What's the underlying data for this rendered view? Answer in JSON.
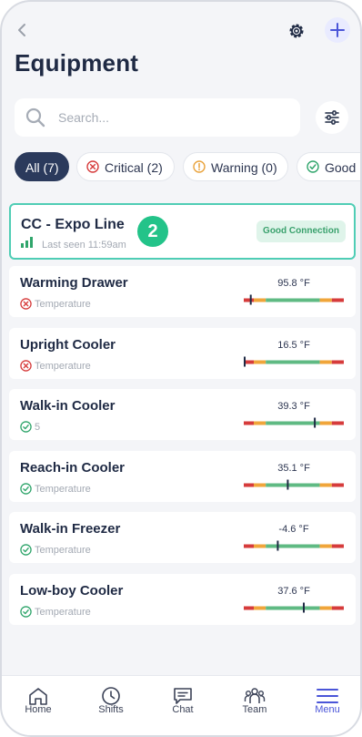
{
  "header": {
    "title": "Equipment"
  },
  "search": {
    "placeholder": "Search..."
  },
  "filters": [
    {
      "label": "All (7)",
      "active": true
    },
    {
      "label": "Critical (2)",
      "icon": "x-circle-icon",
      "color": "#d63b3b"
    },
    {
      "label": "Warning (0)",
      "icon": "warning-circle-icon",
      "color": "#e9a23b"
    },
    {
      "label": "Good",
      "icon": "check-circle-icon",
      "color": "#2fa56b"
    }
  ],
  "hub": {
    "name": "CC - Expo Line",
    "count": "2",
    "last_seen": "Last seen 11:59am",
    "connection": "Good Connection"
  },
  "equipment": [
    {
      "name": "Warming Drawer",
      "status": "critical",
      "sub": "Temperature",
      "temp": "95.8 °F",
      "level": 0.07
    },
    {
      "name": "Upright Cooler",
      "status": "critical",
      "sub": "Temperature",
      "temp": "16.5 °F",
      "level": 0.0
    },
    {
      "name": "Walk-in Cooler",
      "status": "good",
      "sub": "5",
      "temp": "39.3 °F",
      "level": 0.71
    },
    {
      "name": "Reach-in Cooler",
      "status": "good",
      "sub": "Temperature",
      "temp": "35.1 °F",
      "level": 0.44
    },
    {
      "name": "Walk-in Freezer",
      "status": "good",
      "sub": "Temperature",
      "temp": "-4.6 °F",
      "level": 0.34
    },
    {
      "name": "Low-boy Cooler",
      "status": "good",
      "sub": "Temperature",
      "temp": "37.6 °F",
      "level": 0.6
    }
  ],
  "colors": {
    "critical": "#d63b3b",
    "good": "#2fa56b",
    "gauge_red": "#d63b3b",
    "gauge_orange": "#f0a53a",
    "gauge_green": "#5fba83",
    "accent": "#4a55d8"
  },
  "nav": [
    {
      "label": "Home",
      "icon": "home-icon"
    },
    {
      "label": "Shifts",
      "icon": "clock-icon"
    },
    {
      "label": "Chat",
      "icon": "chat-icon"
    },
    {
      "label": "Team",
      "icon": "team-icon"
    },
    {
      "label": "Menu",
      "icon": "menu-icon",
      "active": true
    }
  ]
}
